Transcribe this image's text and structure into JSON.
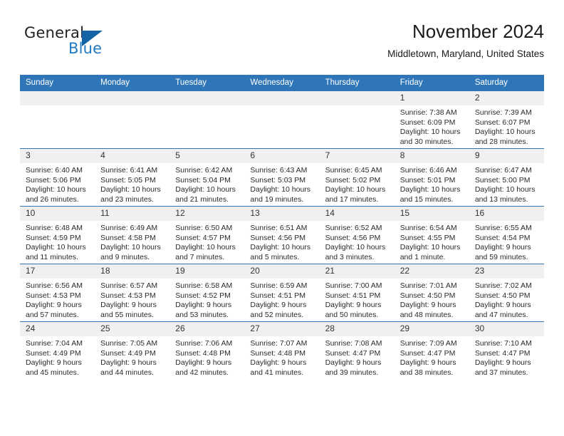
{
  "brand": {
    "name_part1": "General",
    "name_part2": "Blue",
    "flag_color": "#1464a5",
    "blue_color": "#1f7ac4"
  },
  "header": {
    "title": "November 2024",
    "subtitle": "Middletown, Maryland, United States"
  },
  "theme": {
    "header_bar": "#2f76b8",
    "daynum_band": "#f0f0f0",
    "text": "#2a2a2a"
  },
  "columns": [
    "Sunday",
    "Monday",
    "Tuesday",
    "Wednesday",
    "Thursday",
    "Friday",
    "Saturday"
  ],
  "weeks": [
    [
      {
        "blank": true
      },
      {
        "blank": true
      },
      {
        "blank": true
      },
      {
        "blank": true
      },
      {
        "blank": true
      },
      {
        "day": "1",
        "sunrise": "Sunrise: 7:38 AM",
        "sunset": "Sunset: 6:09 PM",
        "daylight1": "Daylight: 10 hours",
        "daylight2": "and 30 minutes."
      },
      {
        "day": "2",
        "sunrise": "Sunrise: 7:39 AM",
        "sunset": "Sunset: 6:07 PM",
        "daylight1": "Daylight: 10 hours",
        "daylight2": "and 28 minutes."
      }
    ],
    [
      {
        "day": "3",
        "sunrise": "Sunrise: 6:40 AM",
        "sunset": "Sunset: 5:06 PM",
        "daylight1": "Daylight: 10 hours",
        "daylight2": "and 26 minutes."
      },
      {
        "day": "4",
        "sunrise": "Sunrise: 6:41 AM",
        "sunset": "Sunset: 5:05 PM",
        "daylight1": "Daylight: 10 hours",
        "daylight2": "and 23 minutes."
      },
      {
        "day": "5",
        "sunrise": "Sunrise: 6:42 AM",
        "sunset": "Sunset: 5:04 PM",
        "daylight1": "Daylight: 10 hours",
        "daylight2": "and 21 minutes."
      },
      {
        "day": "6",
        "sunrise": "Sunrise: 6:43 AM",
        "sunset": "Sunset: 5:03 PM",
        "daylight1": "Daylight: 10 hours",
        "daylight2": "and 19 minutes."
      },
      {
        "day": "7",
        "sunrise": "Sunrise: 6:45 AM",
        "sunset": "Sunset: 5:02 PM",
        "daylight1": "Daylight: 10 hours",
        "daylight2": "and 17 minutes."
      },
      {
        "day": "8",
        "sunrise": "Sunrise: 6:46 AM",
        "sunset": "Sunset: 5:01 PM",
        "daylight1": "Daylight: 10 hours",
        "daylight2": "and 15 minutes."
      },
      {
        "day": "9",
        "sunrise": "Sunrise: 6:47 AM",
        "sunset": "Sunset: 5:00 PM",
        "daylight1": "Daylight: 10 hours",
        "daylight2": "and 13 minutes."
      }
    ],
    [
      {
        "day": "10",
        "sunrise": "Sunrise: 6:48 AM",
        "sunset": "Sunset: 4:59 PM",
        "daylight1": "Daylight: 10 hours",
        "daylight2": "and 11 minutes."
      },
      {
        "day": "11",
        "sunrise": "Sunrise: 6:49 AM",
        "sunset": "Sunset: 4:58 PM",
        "daylight1": "Daylight: 10 hours",
        "daylight2": "and 9 minutes."
      },
      {
        "day": "12",
        "sunrise": "Sunrise: 6:50 AM",
        "sunset": "Sunset: 4:57 PM",
        "daylight1": "Daylight: 10 hours",
        "daylight2": "and 7 minutes."
      },
      {
        "day": "13",
        "sunrise": "Sunrise: 6:51 AM",
        "sunset": "Sunset: 4:56 PM",
        "daylight1": "Daylight: 10 hours",
        "daylight2": "and 5 minutes."
      },
      {
        "day": "14",
        "sunrise": "Sunrise: 6:52 AM",
        "sunset": "Sunset: 4:56 PM",
        "daylight1": "Daylight: 10 hours",
        "daylight2": "and 3 minutes."
      },
      {
        "day": "15",
        "sunrise": "Sunrise: 6:54 AM",
        "sunset": "Sunset: 4:55 PM",
        "daylight1": "Daylight: 10 hours",
        "daylight2": "and 1 minute."
      },
      {
        "day": "16",
        "sunrise": "Sunrise: 6:55 AM",
        "sunset": "Sunset: 4:54 PM",
        "daylight1": "Daylight: 9 hours",
        "daylight2": "and 59 minutes."
      }
    ],
    [
      {
        "day": "17",
        "sunrise": "Sunrise: 6:56 AM",
        "sunset": "Sunset: 4:53 PM",
        "daylight1": "Daylight: 9 hours",
        "daylight2": "and 57 minutes."
      },
      {
        "day": "18",
        "sunrise": "Sunrise: 6:57 AM",
        "sunset": "Sunset: 4:53 PM",
        "daylight1": "Daylight: 9 hours",
        "daylight2": "and 55 minutes."
      },
      {
        "day": "19",
        "sunrise": "Sunrise: 6:58 AM",
        "sunset": "Sunset: 4:52 PM",
        "daylight1": "Daylight: 9 hours",
        "daylight2": "and 53 minutes."
      },
      {
        "day": "20",
        "sunrise": "Sunrise: 6:59 AM",
        "sunset": "Sunset: 4:51 PM",
        "daylight1": "Daylight: 9 hours",
        "daylight2": "and 52 minutes."
      },
      {
        "day": "21",
        "sunrise": "Sunrise: 7:00 AM",
        "sunset": "Sunset: 4:51 PM",
        "daylight1": "Daylight: 9 hours",
        "daylight2": "and 50 minutes."
      },
      {
        "day": "22",
        "sunrise": "Sunrise: 7:01 AM",
        "sunset": "Sunset: 4:50 PM",
        "daylight1": "Daylight: 9 hours",
        "daylight2": "and 48 minutes."
      },
      {
        "day": "23",
        "sunrise": "Sunrise: 7:02 AM",
        "sunset": "Sunset: 4:50 PM",
        "daylight1": "Daylight: 9 hours",
        "daylight2": "and 47 minutes."
      }
    ],
    [
      {
        "day": "24",
        "sunrise": "Sunrise: 7:04 AM",
        "sunset": "Sunset: 4:49 PM",
        "daylight1": "Daylight: 9 hours",
        "daylight2": "and 45 minutes."
      },
      {
        "day": "25",
        "sunrise": "Sunrise: 7:05 AM",
        "sunset": "Sunset: 4:49 PM",
        "daylight1": "Daylight: 9 hours",
        "daylight2": "and 44 minutes."
      },
      {
        "day": "26",
        "sunrise": "Sunrise: 7:06 AM",
        "sunset": "Sunset: 4:48 PM",
        "daylight1": "Daylight: 9 hours",
        "daylight2": "and 42 minutes."
      },
      {
        "day": "27",
        "sunrise": "Sunrise: 7:07 AM",
        "sunset": "Sunset: 4:48 PM",
        "daylight1": "Daylight: 9 hours",
        "daylight2": "and 41 minutes."
      },
      {
        "day": "28",
        "sunrise": "Sunrise: 7:08 AM",
        "sunset": "Sunset: 4:47 PM",
        "daylight1": "Daylight: 9 hours",
        "daylight2": "and 39 minutes."
      },
      {
        "day": "29",
        "sunrise": "Sunrise: 7:09 AM",
        "sunset": "Sunset: 4:47 PM",
        "daylight1": "Daylight: 9 hours",
        "daylight2": "and 38 minutes."
      },
      {
        "day": "30",
        "sunrise": "Sunrise: 7:10 AM",
        "sunset": "Sunset: 4:47 PM",
        "daylight1": "Daylight: 9 hours",
        "daylight2": "and 37 minutes."
      }
    ]
  ]
}
